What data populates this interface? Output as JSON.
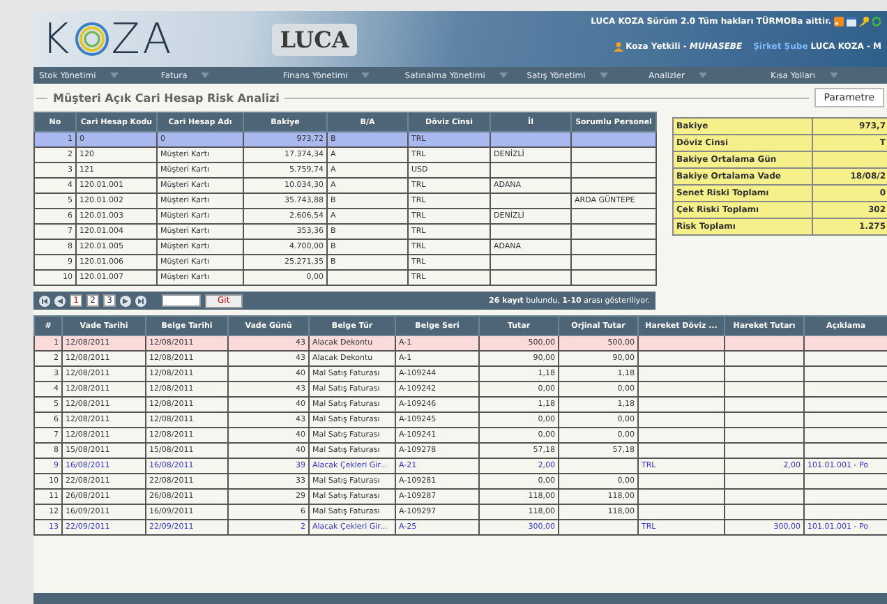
{
  "header": {
    "logo_left": "K",
    "logo_right": "ZA",
    "luca_logo": "LUCA",
    "version_text": "LUCA KOZA Sürüm 2.0 Tüm hakları TÜRMOBa aittir.",
    "user": "Koza Yetkili - *MUHASEBE*",
    "company_label": "Şirket Şube",
    "company": "LUCA KOZA - M"
  },
  "menu": [
    "Stok Yönetimi",
    "Fatura",
    "Finans Yönetimi",
    "Satınalma Yönetimi",
    "Satış Yönetimi",
    "Analizler",
    "Kısa Yolları"
  ],
  "section_title": "Müşteri Açık Cari Hesap Risk Analizi",
  "parameters_button": "Parametre",
  "top_table": {
    "columns": [
      "No",
      "Cari Hesap Kodu",
      "Cari Hesap Adı",
      "Bakiye",
      "B/A",
      "Döviz Cinsi",
      "İl",
      "Sorumlu Personel"
    ],
    "rows": [
      {
        "selected": true,
        "cells": [
          "1",
          "0",
          "0",
          "973,72",
          "B",
          "TRL",
          null,
          null
        ]
      },
      {
        "selected": false,
        "cells": [
          "2",
          "120",
          "Müşteri Kartı",
          "17.374,34",
          "A",
          "TRL",
          "DENİZLİ",
          null
        ]
      },
      {
        "selected": false,
        "cells": [
          "3",
          "121",
          "Müşteri Kartı",
          "5.759,74",
          "A",
          "USD",
          null,
          null
        ]
      },
      {
        "selected": false,
        "cells": [
          "4",
          "120.01.001",
          "Müşteri Kartı",
          "10.034,30",
          "A",
          "TRL",
          "ADANA",
          null
        ]
      },
      {
        "selected": false,
        "cells": [
          "5",
          "120.01.002",
          "Müşteri Kartı",
          "35.743,88",
          "B",
          "TRL",
          null,
          "ARDA GÜNTEPE"
        ]
      },
      {
        "selected": false,
        "cells": [
          "6",
          "120.01.003",
          "Müşteri Kartı",
          "2.606,54",
          "A",
          "TRL",
          "DENİZLİ",
          null
        ]
      },
      {
        "selected": false,
        "cells": [
          "7",
          "120.01.004",
          "Müşteri Kartı",
          "353,36",
          "B",
          "TRL",
          null,
          null
        ]
      },
      {
        "selected": false,
        "cells": [
          "8",
          "120.01.005",
          "Müşteri Kartı",
          "4.700,00",
          "B",
          "TRL",
          "ADANA",
          null
        ]
      },
      {
        "selected": false,
        "cells": [
          "9",
          "120.01.006",
          "Müşteri Kartı",
          "25.271,35",
          "B",
          "TRL",
          null,
          null
        ]
      },
      {
        "selected": false,
        "cells": [
          "10",
          "120.01.007",
          "Müşteri Kartı",
          "0,00",
          null,
          "TRL",
          null,
          null
        ]
      }
    ]
  },
  "summary": [
    {
      "label": "Bakiye",
      "value": "973,7"
    },
    {
      "label": "Döviz Cinsi",
      "value": "T"
    },
    {
      "label": "Bakiye Ortalama Gün"
    },
    {
      "label": "Bakiye Ortalama Vade",
      "value": "18/08/2"
    },
    {
      "label": "Senet Riski Toplamı",
      "value": "0"
    },
    {
      "label": "Çek Riski Toplamı",
      "value": "302"
    },
    {
      "label": "Risk Toplamı",
      "value": "1.275"
    }
  ],
  "pager": {
    "pages": [
      {
        "label": "1",
        "selected": true
      },
      {
        "label": "2",
        "selected": false
      },
      {
        "label": "3",
        "selected": false
      }
    ],
    "go_button": "Git",
    "status": "**26 kayıt** bulundu, **1-10** arası gösteriliyor."
  },
  "bottom_table": {
    "columns": [
      "#",
      "Vade Tarihi",
      "Belge Tarihi",
      "Vade Günü",
      "Belge Tür",
      "Belge Seri",
      "Tutar",
      "Orjinal Tutar",
      "Hareket Döviz ...",
      "Hareket Tutarı",
      "Açıklama"
    ],
    "rows": [
      {
        "selected": true,
        "kind": "normal",
        "cells": [
          "1",
          "12/08/2011",
          "12/08/2011",
          "43",
          "Alacak Dekontu",
          "A-1",
          "500,00",
          "500,00",
          null,
          null,
          null
        ]
      },
      {
        "selected": false,
        "kind": "normal",
        "cells": [
          "2",
          "12/08/2011",
          "12/08/2011",
          "43",
          "Alacak Dekontu",
          "A-1",
          "90,00",
          "90,00",
          null,
          null,
          null
        ]
      },
      {
        "selected": false,
        "kind": "normal",
        "cells": [
          "3",
          "12/08/2011",
          "12/08/2011",
          "40",
          "Mal Satış Faturası",
          "A-109244",
          "1,18",
          "1,18",
          null,
          null,
          null
        ]
      },
      {
        "selected": false,
        "kind": "normal",
        "cells": [
          "4",
          "12/08/2011",
          "12/08/2011",
          "43",
          "Mal Satış Faturası",
          "A-109242",
          "0,00",
          "0,00",
          null,
          null,
          null
        ]
      },
      {
        "selected": false,
        "kind": "normal",
        "cells": [
          "5",
          "12/08/2011",
          "12/08/2011",
          "40",
          "Mal Satış Faturası",
          "A-109246",
          "1,18",
          "1,18",
          null,
          null,
          null
        ]
      },
      {
        "selected": false,
        "kind": "normal",
        "cells": [
          "6",
          "12/08/2011",
          "12/08/2011",
          "43",
          "Mal Satış Faturası",
          "A-109245",
          "0,00",
          "0,00",
          null,
          null,
          null
        ]
      },
      {
        "selected": false,
        "kind": "normal",
        "cells": [
          "7",
          "12/08/2011",
          "12/08/2011",
          "40",
          "Mal Satış Faturası",
          "A-109241",
          "0,00",
          "0,00",
          null,
          null,
          null
        ]
      },
      {
        "selected": false,
        "kind": "normal",
        "cells": [
          "8",
          "15/08/2011",
          "15/08/2011",
          "40",
          "Mal Satış Faturası",
          "A-109278",
          "57,18",
          "57,18",
          null,
          null,
          null
        ]
      },
      {
        "selected": false,
        "kind": "cheque",
        "cells": [
          "9",
          "16/08/2011",
          "16/08/2011",
          "39",
          "Alacak Çekleri Gir...",
          "A-21",
          "2,00",
          null,
          "TRL",
          "2,00",
          "101.01.001 - Po"
        ]
      },
      {
        "selected": false,
        "kind": "normal",
        "cells": [
          "10",
          "22/08/2011",
          "22/08/2011",
          "33",
          "Mal Satış Faturası",
          "A-109281",
          "0,00",
          "0,00",
          null,
          null,
          null
        ]
      },
      {
        "selected": false,
        "kind": "normal",
        "cells": [
          "11",
          "26/08/2011",
          "26/08/2011",
          "29",
          "Mal Satış Faturası",
          "A-109287",
          "118,00",
          "118,00",
          null,
          null,
          null
        ]
      },
      {
        "selected": false,
        "kind": "normal",
        "cells": [
          "12",
          "16/09/2011",
          "16/09/2011",
          "6",
          "Mal Satış Faturası",
          "A-109297",
          "118,00",
          "118,00",
          null,
          null,
          null
        ]
      },
      {
        "selected": false,
        "kind": "cheque",
        "cells": [
          "13",
          "22/09/2011",
          "22/09/2011",
          "2",
          "Alacak Çekleri Gir...",
          "A-25",
          "300,00",
          null,
          "TRL",
          "300,00",
          "101.01.001 - Po"
        ]
      }
    ]
  }
}
